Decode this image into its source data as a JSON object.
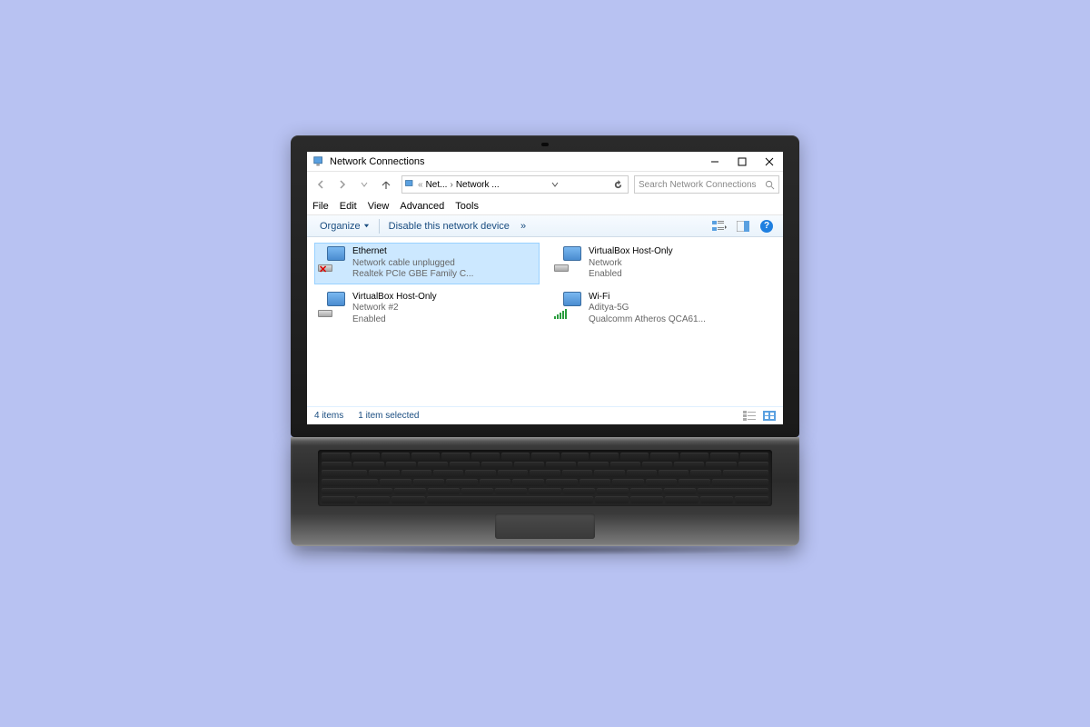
{
  "window": {
    "title": "Network Connections",
    "breadcrumb": {
      "seg1": "Net...",
      "seg2": "Network ..."
    }
  },
  "search": {
    "placeholder": "Search Network Connections"
  },
  "menu": {
    "file": "File",
    "edit": "Edit",
    "view": "View",
    "advanced": "Advanced",
    "tools": "Tools"
  },
  "toolbar": {
    "organize": "Organize",
    "disable": "Disable this network device",
    "chevron": "»"
  },
  "adapters": [
    {
      "name": "Ethernet",
      "status": "Network cable unplugged",
      "device": "Realtek PCIe GBE Family C...",
      "selected": true,
      "unplugged": true,
      "type": "ethernet"
    },
    {
      "name": "VirtualBox Host-Only",
      "status": "Network",
      "device": "Enabled",
      "selected": false,
      "type": "ethernet"
    },
    {
      "name": "VirtualBox Host-Only",
      "status": "Network #2",
      "device": "Enabled",
      "selected": false,
      "type": "ethernet"
    },
    {
      "name": "Wi-Fi",
      "status": "Aditya-5G",
      "device": "Qualcomm Atheros QCA61...",
      "selected": false,
      "type": "wifi"
    }
  ],
  "statusbar": {
    "items": "4 items",
    "selected": "1 item selected"
  },
  "help_glyph": "?"
}
